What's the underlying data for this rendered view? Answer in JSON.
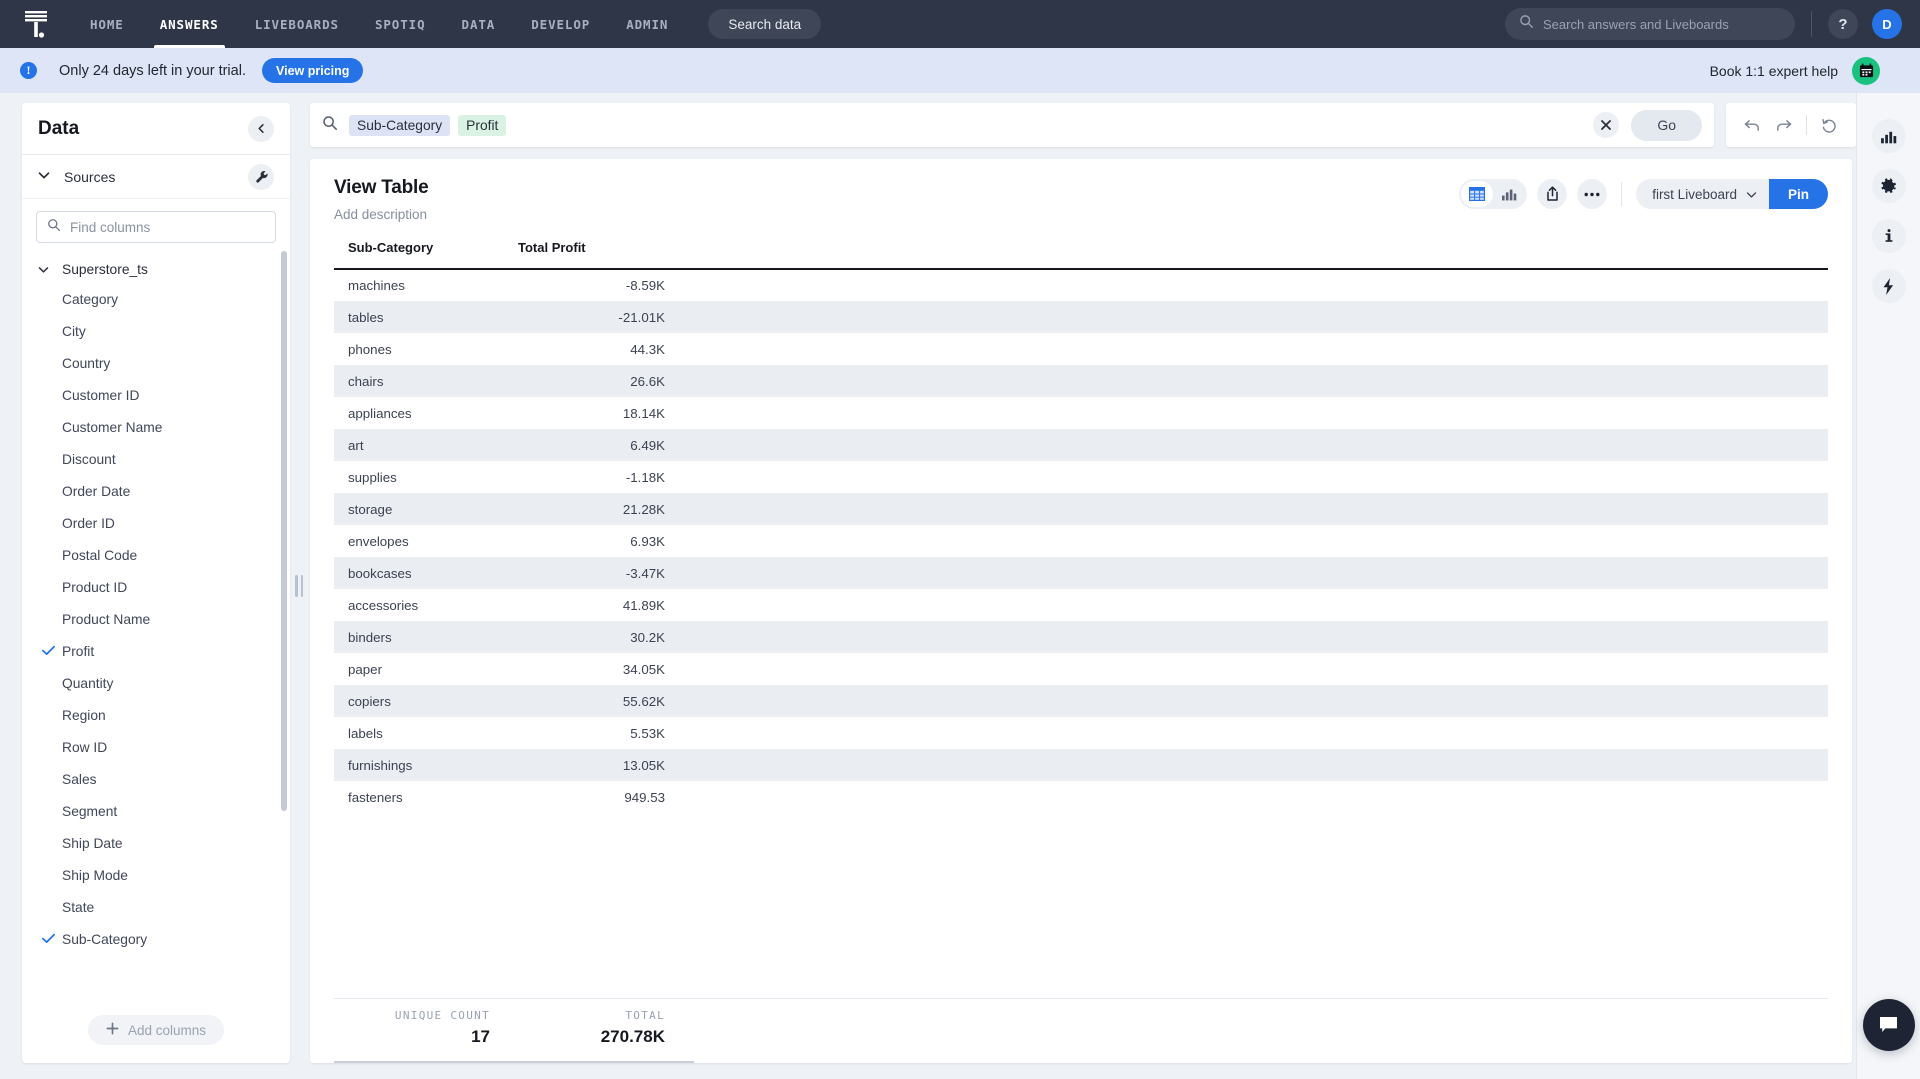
{
  "topnav": {
    "logo_icon": "thoughtspot-logo-icon",
    "items": [
      {
        "label": "HOME",
        "active": false
      },
      {
        "label": "ANSWERS",
        "active": true
      },
      {
        "label": "LIVEBOARDS",
        "active": false
      },
      {
        "label": "SPOTIQ",
        "active": false
      },
      {
        "label": "DATA",
        "active": false
      },
      {
        "label": "DEVELOP",
        "active": false
      },
      {
        "label": "ADMIN",
        "active": false
      }
    ],
    "search_data_label": "Search data",
    "global_search_placeholder": "Search answers and Liveboards",
    "help_label": "?",
    "avatar_initial": "D"
  },
  "banner": {
    "info_icon": "info-icon",
    "message": "Only 24 days left in your trial.",
    "cta_label": "View pricing",
    "expert_help_label": "Book 1:1 expert help",
    "calendar_icon": "calendar-icon",
    "background": "#dde5f7",
    "accent": "#2673e8"
  },
  "sidebar": {
    "title": "Data",
    "collapse_icon": "chevron-left-icon",
    "sources_label": "Sources",
    "wrench_icon": "wrench-icon",
    "find_placeholder": "Find columns",
    "find_value": "",
    "source_name": "Superstore_ts",
    "columns": [
      {
        "label": "Category",
        "selected": false
      },
      {
        "label": "City",
        "selected": false
      },
      {
        "label": "Country",
        "selected": false
      },
      {
        "label": "Customer ID",
        "selected": false
      },
      {
        "label": "Customer Name",
        "selected": false
      },
      {
        "label": "Discount",
        "selected": false
      },
      {
        "label": "Order Date",
        "selected": false
      },
      {
        "label": "Order ID",
        "selected": false
      },
      {
        "label": "Postal Code",
        "selected": false
      },
      {
        "label": "Product ID",
        "selected": false
      },
      {
        "label": "Product Name",
        "selected": false
      },
      {
        "label": "Profit",
        "selected": true
      },
      {
        "label": "Quantity",
        "selected": false
      },
      {
        "label": "Region",
        "selected": false
      },
      {
        "label": "Row ID",
        "selected": false
      },
      {
        "label": "Sales",
        "selected": false
      },
      {
        "label": "Segment",
        "selected": false
      },
      {
        "label": "Ship Date",
        "selected": false
      },
      {
        "label": "Ship Mode",
        "selected": false
      },
      {
        "label": "State",
        "selected": false
      },
      {
        "label": "Sub-Category",
        "selected": true
      }
    ],
    "add_columns_label": "Add columns"
  },
  "searchbar": {
    "search_icon": "search-icon",
    "tokens": [
      {
        "label": "Sub-Category",
        "kind": "attribute",
        "color": "#dde2f5"
      },
      {
        "label": "Profit",
        "kind": "measure",
        "color": "#d9f2e4"
      }
    ],
    "clear_icon": "close-icon",
    "go_label": "Go",
    "undo_icon": "undo-icon",
    "redo_icon": "redo-icon",
    "reset_icon": "reset-icon"
  },
  "answer": {
    "title": "View Table",
    "description_placeholder": "Add description",
    "viz_table_icon": "table-view-icon",
    "viz_chart_icon": "bar-chart-icon",
    "share_icon": "share-icon",
    "more_icon": "more-horizontal-icon",
    "liveboard_selected": "first Liveboard",
    "liveboard_chevron_icon": "chevron-down-icon",
    "pin_label": "Pin"
  },
  "chart_data": {
    "type": "table",
    "title": "View Table",
    "columns": [
      "Sub-Category",
      "Total Profit"
    ],
    "categories": [
      "machines",
      "tables",
      "phones",
      "chairs",
      "appliances",
      "art",
      "supplies",
      "storage",
      "envelopes",
      "bookcases",
      "accessories",
      "binders",
      "paper",
      "copiers",
      "labels",
      "furnishings",
      "fasteners"
    ],
    "values": [
      -8590,
      -21010,
      44300,
      26600,
      18140,
      6490,
      -1180,
      21280,
      6930,
      -3470,
      41890,
      30200,
      34050,
      55620,
      5530,
      13050,
      949.53
    ],
    "value_labels": [
      "-8.59K",
      "-21.01K",
      "44.3K",
      "26.6K",
      "18.14K",
      "6.49K",
      "-1.18K",
      "21.28K",
      "6.93K",
      "-3.47K",
      "41.89K",
      "30.2K",
      "34.05K",
      "55.62K",
      "5.53K",
      "13.05K",
      "949.53"
    ],
    "xlabel": "Sub-Category",
    "ylabel": "Total Profit",
    "rows": [
      {
        "sub_category": "machines",
        "total_profit": "-8.59K"
      },
      {
        "sub_category": "tables",
        "total_profit": "-21.01K"
      },
      {
        "sub_category": "phones",
        "total_profit": "44.3K"
      },
      {
        "sub_category": "chairs",
        "total_profit": "26.6K"
      },
      {
        "sub_category": "appliances",
        "total_profit": "18.14K"
      },
      {
        "sub_category": "art",
        "total_profit": "6.49K"
      },
      {
        "sub_category": "supplies",
        "total_profit": "-1.18K"
      },
      {
        "sub_category": "storage",
        "total_profit": "21.28K"
      },
      {
        "sub_category": "envelopes",
        "total_profit": "6.93K"
      },
      {
        "sub_category": "bookcases",
        "total_profit": "-3.47K"
      },
      {
        "sub_category": "accessories",
        "total_profit": "41.89K"
      },
      {
        "sub_category": "binders",
        "total_profit": "30.2K"
      },
      {
        "sub_category": "paper",
        "total_profit": "34.05K"
      },
      {
        "sub_category": "copiers",
        "total_profit": "55.62K"
      },
      {
        "sub_category": "labels",
        "total_profit": "5.53K"
      },
      {
        "sub_category": "furnishings",
        "total_profit": "13.05K"
      },
      {
        "sub_category": "fasteners",
        "total_profit": "949.53"
      }
    ],
    "summary": {
      "unique_count_label": "UNIQUE COUNT",
      "unique_count_value": "17",
      "total_label": "TOTAL",
      "total_value": "270.78K"
    }
  },
  "right_rail": {
    "chart_icon": "bar-chart-icon",
    "settings_icon": "gear-icon",
    "info_icon": "info-icon",
    "insights_icon": "lightning-bolt-icon",
    "chat_icon": "chat-bubble-icon"
  }
}
